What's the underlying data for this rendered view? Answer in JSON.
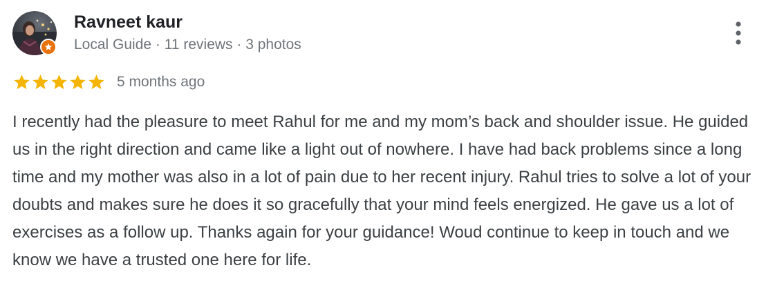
{
  "reviewer": {
    "name": "Ravneet kaur",
    "meta": "Local Guide · 11 reviews · 3 photos",
    "badge_icon": "local-guide-star-icon",
    "badge_color": "#e8710a"
  },
  "rating": {
    "stars": 5,
    "max_stars": 5,
    "star_color": "#f4b400",
    "date": "5 months ago"
  },
  "review": {
    "text": "I recently had the pleasure to meet Rahul for me and my mom’s back and shoulder issue. He guided us in the right direction and came like a light out of nowhere. I have had back problems since a long time and my mother was also in a lot of pain due to her recent injury. Rahul tries to solve a lot of your doubts and makes sure he does it so gracefully that your mind feels energized. He gave us a lot of exercises as a follow up. Thanks again for your guidance! Woud continue to keep in touch and we know we have a trusted one here for life."
  },
  "actions": {
    "more_icon": "more-vertical-icon"
  }
}
